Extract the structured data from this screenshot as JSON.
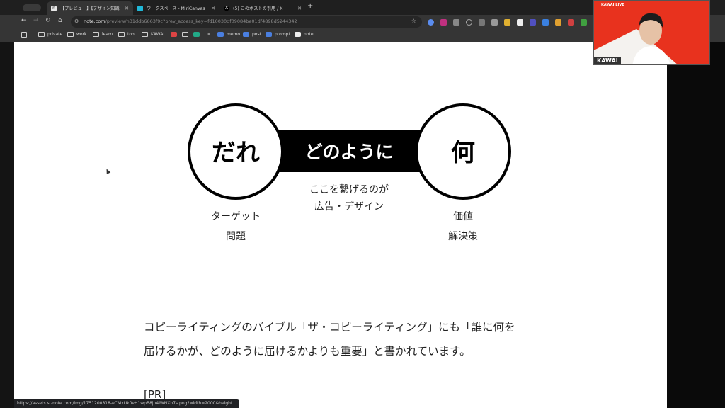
{
  "browser": {
    "tabs": [
      {
        "label": "【プレビュー】【デザイン知識な",
        "favicon": "note-icon",
        "color": "#e8e8e8"
      },
      {
        "label": "ワークスペース - MiriCanvas",
        "favicon": "miricanvas-icon",
        "color": "#20b8d8"
      },
      {
        "label": "(5) このポストの引用 / X",
        "favicon": "x-icon",
        "color": "#000000"
      }
    ],
    "new_tab": "+",
    "url_domain": "note.com",
    "url_path": "/preview/n31ddb6663f9c?prev_access_key=fd10030df09084be01df4898d5244342",
    "bookmarks": [
      "private",
      "work",
      "learn",
      "tool",
      "KAWAI",
      ">",
      "memo",
      "post",
      "prompt",
      "note"
    ]
  },
  "diagram": {
    "left_circle": "だれ",
    "middle_bar": "どのように",
    "right_circle": "何",
    "left_caption": [
      "ターゲット",
      "問題"
    ],
    "middle_caption": [
      "ここを繋げるのが",
      "広告・デザイン"
    ],
    "right_caption": [
      "価値",
      "解決策"
    ]
  },
  "article": {
    "line1": "コピーライティングのバイブル「ザ・コピーライティング」にも「誰に何を",
    "line2": "届けるかが、どのように届けるかよりも重要」と書かれています。",
    "pr": "[PR]"
  },
  "status_url": "https://assets.st-note.com/img/1751200818-eCMxUk0vH1wpB8jn4iWNXh7s.png?width=2000&height...",
  "webcam": {
    "live_label": "KAWAI LIVE",
    "brand": "KAWAI",
    "accent": "#e8321e"
  }
}
